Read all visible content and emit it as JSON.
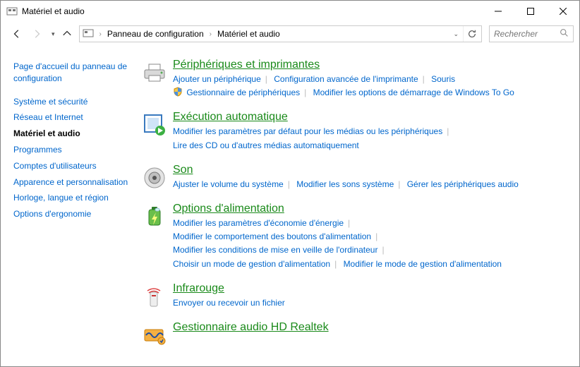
{
  "window": {
    "title": "Matériel et audio"
  },
  "breadcrumb": {
    "root": "Panneau de configuration",
    "current": "Matériel et audio"
  },
  "search": {
    "placeholder": "Rechercher"
  },
  "sidebar": {
    "items": [
      {
        "label": "Page d'accueil du panneau de configuration",
        "active": false
      },
      {
        "label": "Système et sécurité",
        "active": false
      },
      {
        "label": "Réseau et Internet",
        "active": false
      },
      {
        "label": "Matériel et audio",
        "active": true
      },
      {
        "label": "Programmes",
        "active": false
      },
      {
        "label": "Comptes d'utilisateurs",
        "active": false
      },
      {
        "label": "Apparence et personnalisation",
        "active": false
      },
      {
        "label": "Horloge, langue et région",
        "active": false
      },
      {
        "label": "Options d'ergonomie",
        "active": false
      }
    ]
  },
  "categories": {
    "devices": {
      "title": "Périphériques et imprimantes",
      "links": {
        "add": "Ajouter un périphérique",
        "advprint": "Configuration avancée de l'imprimante",
        "mouse": "Souris",
        "devmgr": "Gestionnaire de périphériques",
        "wintogo": "Modifier les options de démarrage de Windows To Go"
      }
    },
    "autoplay": {
      "title": "Exécution automatique",
      "links": {
        "defaults": "Modifier les paramètres par défaut pour les médias ou les périphériques",
        "cds": "Lire des CD ou d'autres médias automatiquement"
      }
    },
    "sound": {
      "title": "Son",
      "links": {
        "volume": "Ajuster le volume du système",
        "sounds": "Modifier les sons système",
        "audiodev": "Gérer les périphériques audio"
      }
    },
    "power": {
      "title": "Options d'alimentation",
      "links": {
        "econ": "Modifier les paramètres d'économie d'énergie",
        "buttons": "Modifier le comportement des boutons d'alimentation",
        "sleep": "Modifier les conditions de mise en veille de l'ordinateur",
        "plan": "Choisir un mode de gestion d'alimentation",
        "editplan": "Modifier le mode de gestion d'alimentation"
      }
    },
    "infrared": {
      "title": "Infrarouge",
      "links": {
        "send": "Envoyer ou recevoir un fichier"
      }
    },
    "realtek": {
      "title": "Gestionnaire audio HD Realtek"
    }
  }
}
